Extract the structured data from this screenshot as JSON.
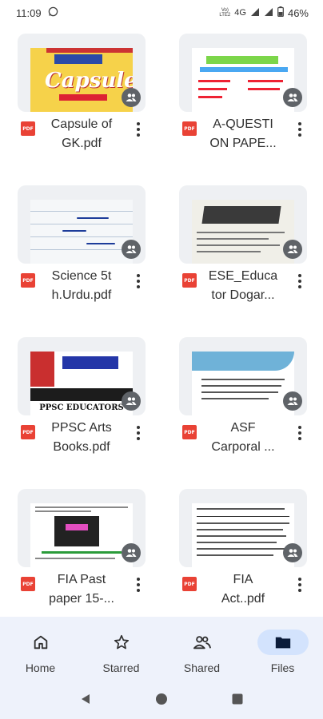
{
  "status_bar": {
    "time": "11:09",
    "volte": "Vo)\nLTE2",
    "network": "4G",
    "battery": "46%"
  },
  "files": [
    {
      "name_line1": "Capsule of",
      "name_line2": "GK.pdf",
      "type": "PDF"
    },
    {
      "name_line1": "A-QUESTI",
      "name_line2": "ON PAPE...",
      "type": "PDF"
    },
    {
      "name_line1": "Science 5t",
      "name_line2": "h.Urdu.pdf",
      "type": "PDF"
    },
    {
      "name_line1": "ESE_Educa",
      "name_line2": "tor Dogar...",
      "type": "PDF"
    },
    {
      "name_line1": "PPSC Arts",
      "name_line2": "Books.pdf",
      "type": "PDF"
    },
    {
      "name_line1": "ASF",
      "name_line2": "Carporal ...",
      "type": "PDF"
    },
    {
      "name_line1": "FIA Past",
      "name_line2": "paper 15-...",
      "type": "PDF"
    },
    {
      "name_line1": "FIA",
      "name_line2": "Act..pdf",
      "type": "PDF"
    }
  ],
  "thumbnails": {
    "capsule_title": "Capsule",
    "question_title": "QUESTION PAPER",
    "ppsc_title": "PPSC EDUCATORS",
    "ppsc_bs": "BS 14,15,16"
  },
  "bottom_nav": [
    {
      "label": "Home",
      "icon": "home-icon"
    },
    {
      "label": "Starred",
      "icon": "star-icon"
    },
    {
      "label": "Shared",
      "icon": "people-icon"
    },
    {
      "label": "Files",
      "icon": "folder-icon"
    }
  ],
  "colors": {
    "pdf_red": "#e94235",
    "nav_bg": "#eef2fb",
    "active_pill": "#d3e3fd"
  }
}
